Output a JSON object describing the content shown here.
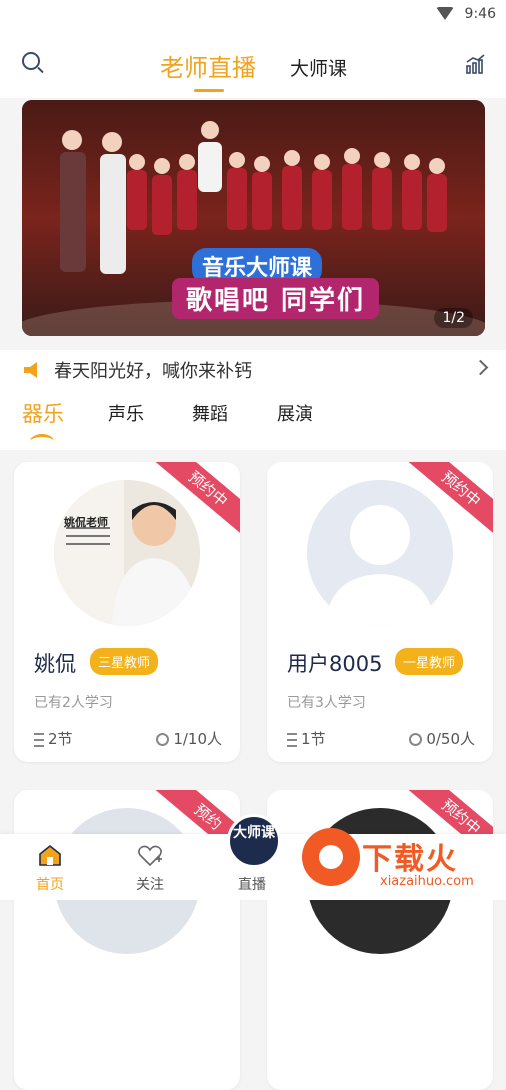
{
  "status_bar": {
    "time": "9:46"
  },
  "top_nav": {
    "tabs": [
      {
        "label": "老师直播"
      },
      {
        "label": "大师课"
      }
    ]
  },
  "banner": {
    "title_top": "音乐大师课",
    "title_main": "歌唱吧 同学们",
    "pager": "1/2"
  },
  "notice": {
    "text": "春天阳光好，喊你来补钙"
  },
  "categories": [
    {
      "label": "器乐"
    },
    {
      "label": "声乐"
    },
    {
      "label": "舞蹈"
    },
    {
      "label": "展演"
    }
  ],
  "cards": [
    {
      "ribbon": "预约中",
      "avatar_caption": "姚侃老师",
      "name": "姚侃",
      "badge": "三星教师",
      "learners": "已有2人学习",
      "lessons": "2节",
      "capacity": "1/10人"
    },
    {
      "ribbon": "预约中",
      "name": "用户8005",
      "badge": "一星教师",
      "learners": "已有3人学习",
      "lessons": "1节",
      "capacity": "0/50人"
    },
    {
      "ribbon": "预约"
    },
    {
      "ribbon": "预约中"
    }
  ],
  "bottom_nav": {
    "items": [
      {
        "label": "首页"
      },
      {
        "label": "关注"
      },
      {
        "label": "直播"
      }
    ],
    "live_badge": "大师课"
  },
  "watermark": {
    "text": "下载火",
    "url": "xiazaihuo.com"
  },
  "colors": {
    "accent": "#f3a21b",
    "ribbon": "#e44a63",
    "badge": "#f3b21b",
    "navy": "#1d2b4c"
  }
}
